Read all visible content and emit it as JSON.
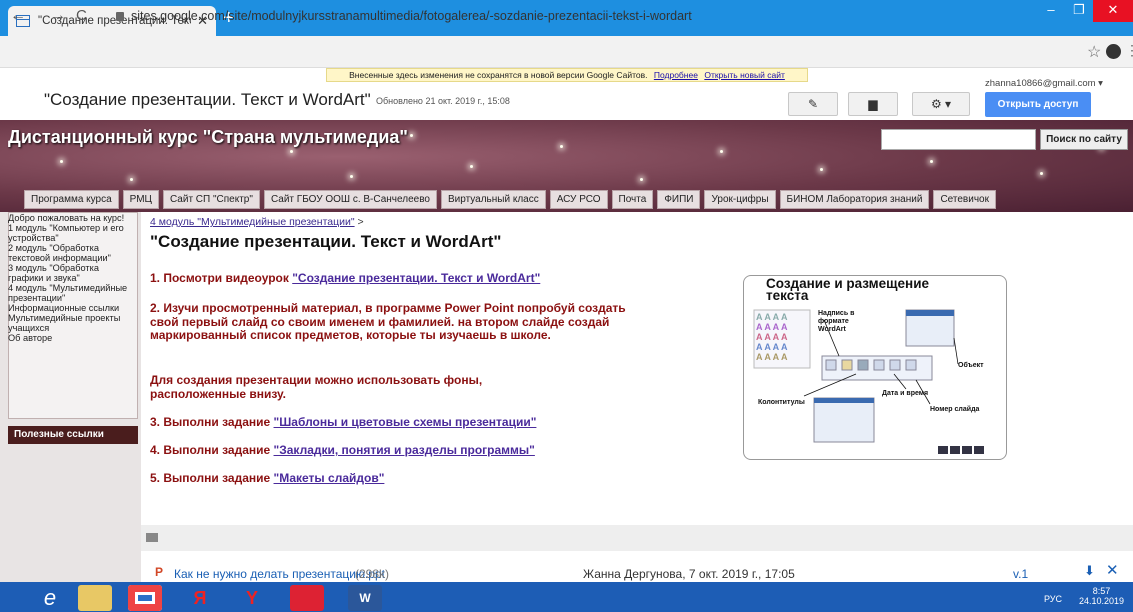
{
  "browser": {
    "tab_title": "\"Создание презентации. Текст и",
    "tab_close": "✕",
    "new_tab": "+",
    "url": "sites.google.com/site/modulnyjkursstranamultimedia/fotogalerea/-sozdanie-prezentacii-tekst-i-wordart",
    "back": "←",
    "forward": "→",
    "reload": "C",
    "star": "☆",
    "menu": "⋮",
    "min": "–",
    "max": "❐",
    "close": "✕"
  },
  "sites_header": {
    "notice_text": "Внесенные здесь изменения не сохранятся в новой версии Google Сайтов.",
    "notice_link1": "Подробнее",
    "notice_link2": "Открыть новый сайт",
    "account": "zhanna10866@gmail.com ▾",
    "page_title": "\"Создание презентации. Текст и WordArt\"",
    "updated": "Обновлено 21 окт. 2019 г., 15:08",
    "edit_icon": "✎",
    "page_icon": "▆",
    "gear": "⚙ ▾",
    "share_label": "Открыть доступ"
  },
  "banner": {
    "site_title": "Дистанционный курс \"Страна мультимедиа\"",
    "search_button": "Поиск по сайту"
  },
  "top_nav": [
    "Программа курса",
    "РМЦ",
    "Сайт СП \"Спектр\"",
    "Сайт ГБОУ ООШ с. В-Санчелеево",
    "Виртуальный класс",
    "АСУ РСО",
    "Почта",
    "ФИПИ",
    "Урок-цифры",
    "БИНОМ Лаборатория знаний",
    "Сетевичок"
  ],
  "sidebar": {
    "items": [
      "Добро пожаловать на курс!",
      "1 модуль \"Компьютер и его устройства\"",
      "2 модуль \"Обработка текстовой информации\"",
      "3 модуль \"Обработка графики и звука\"",
      "4 модуль \"Мультимедийные презентации\"",
      "Информационные ссылки",
      "Мультимедийные проекты учащихся",
      "Об авторе"
    ],
    "useful_links": "Полезные ссылки"
  },
  "content": {
    "breadcrumb_link": "4 модуль \"Мультимедийные презентации\"",
    "breadcrumb_sep": " >",
    "heading": "\"Создание презентации. Текст и WordArt\"",
    "p1_text": "1. Посмотри видеоурок ",
    "p1_link": "\"Создание презентации. Текст и WordArt\"",
    "p2": "2. Изучи просмотренный материал, в программе Power Point попробуй создать свой первый слайд  со своим именем и фамилией. на втором слайде создай маркированный список предметов, которые ты изучаешь в школе.",
    "p3": "Для создания презентации можно использовать фоны, расположенные внизу.",
    "p4_text": "3. Выполни задание ",
    "p4_link": "\"Шаблоны и цветовые схемы презентации\"",
    "p5_text": "4. Выполни задание ",
    "p5_link": "\"Закладки, понятия и разделы программы\"",
    "p6_text": "5. Выполни задание ",
    "p6_link": "\"Макеты слайдов\""
  },
  "slide_image": {
    "title_line1": "Создание и размещение",
    "title_line2": "текста",
    "label_wordart": "Надпись в формате WordArt",
    "label_object": "Объект",
    "label_datetime": "Дата и время",
    "label_footers": "Колонтитулы",
    "label_slidenum": "Номер слайда"
  },
  "attachment": {
    "icon": "P",
    "name": "Как не нужно делать презентацию.ppt",
    "size": "(298k)",
    "author": "Жанна Дергунова, 7 окт. 2019 г., 17:05",
    "version": "v.1",
    "download": "⬇",
    "delete": "✕"
  },
  "taskbar": {
    "lang": "РУС",
    "time": "8:57",
    "date": "24.10.2019"
  },
  "colors": {
    "chrome_blue": "#1e8fe0",
    "banner": "#6b3848",
    "content_red": "#8b1010",
    "link": "#4a2a9b",
    "taskbar": "#1d5db5"
  }
}
